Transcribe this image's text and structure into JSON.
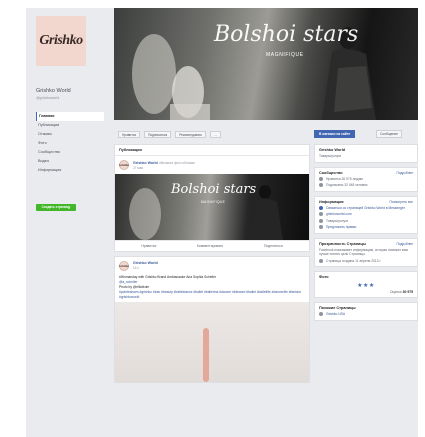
{
  "colors": {
    "brand": "#4267b2",
    "green": "#42b72a",
    "link": "#385898"
  },
  "sidebar": {
    "logo": "Grishko",
    "page_name": "Grishko World",
    "handle": "@grishkoworld",
    "items": [
      {
        "label": "Главная"
      },
      {
        "label": "Публикации"
      },
      {
        "label": "Отзывы"
      },
      {
        "label": "Фото"
      },
      {
        "label": "Сообщество"
      },
      {
        "label": "Видео"
      },
      {
        "label": "Информация"
      }
    ],
    "create_button": "Создать страницу"
  },
  "cover": {
    "title": "Bolshoi stars",
    "subtitle": "MAGNIFIQUE"
  },
  "actions": {
    "like": "Нравится",
    "follow": "Подписаться",
    "recommend": "Рекомендовать",
    "more": "...",
    "primary": "В магазин на сайте",
    "message": "Сообщение"
  },
  "feed": {
    "header": "Публикации",
    "post1": {
      "author": "Grishko World",
      "sub": "обновила фото обложки",
      "time": "27 мая",
      "image_title": "Bolshoi stars",
      "image_sub": "MAGNIFIQUE",
      "like": "Нравится",
      "comment": "Комментировать",
      "share": "Поделиться"
    },
    "post2": {
      "author": "Grishko World",
      "time": "14 ч",
      "line1": "#Womanday with Grishko Brand Ambassador Ana Sophia Scheller",
      "line2": "@a_scheller",
      "line3": "Photo by @elliotknie",
      "tags": "#pointeshoes #grishko #tutu #beauty #balletdance #ballet #ballerina #dancer #blessed #ballet #balletlife #dancerlife #fashion #grishkoworld"
    }
  },
  "right": {
    "about_title": "Grishko World",
    "about_line": "Товары/услуги",
    "community_title": "Сообщество",
    "community_link": "Подробнее",
    "likes": "Нравится 26 975 людям",
    "followers": "Подписаны 32 048 человек",
    "info_title": "Информация",
    "info_link": "Посмотреть все",
    "info1": "Связаться со страницей Grishko World в Messenger",
    "info2": "grishkoworld.com",
    "info3": "Товары/услуги",
    "info4": "Предложить правки",
    "transp_title": "Прозрачность Страницы",
    "transp_link": "Подробнее",
    "transp_text": "Facebook показывает информацию, которая поможет вам лучше понять цель Страницы.",
    "created": "Страница создана 11 апреля 2012 г.",
    "rating_title": "Фото",
    "stars": "★★★",
    "score_label": "Оценка",
    "score": "30 975",
    "related_title": "Похожие Страницы",
    "related1": "Grishko USA"
  }
}
